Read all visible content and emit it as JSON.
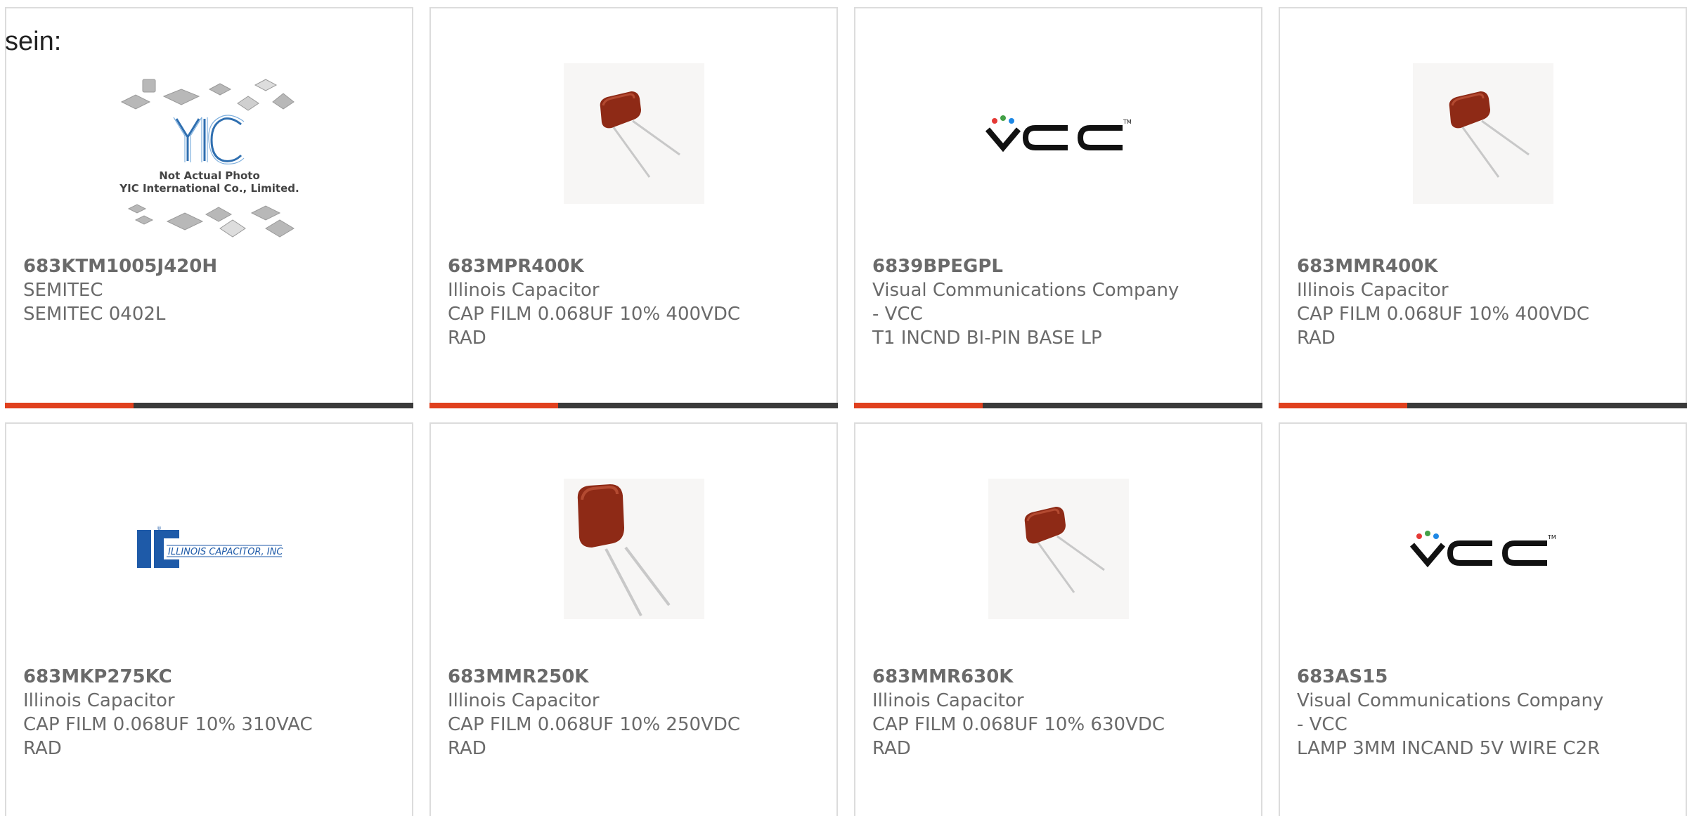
{
  "intro_text": "sein:",
  "theme": {
    "accent_color": "#e0401e",
    "bar_dark_color": "#3a3a3a",
    "text_color": "#6a6a6a"
  },
  "products": [
    {
      "part_number": "683KTM1005J420H",
      "manufacturer": "SEMITEC",
      "description": "SEMITEC 0402L",
      "image": "not-actual-photo-yic",
      "image_text": {
        "logo": "YIC",
        "line1": "Not Actual Photo",
        "line2": "YIC International Co., Limited."
      }
    },
    {
      "part_number": "683MPR400K",
      "manufacturer": "Illinois Capacitor",
      "description": "CAP FILM 0.068UF 10% 400VDC\nRAD",
      "image": "film-capacitor-photo"
    },
    {
      "part_number": "6839BPEGPL",
      "manufacturer": "Visual Communications Company\n- VCC",
      "description": "T1 INCND BI-PIN BASE LP",
      "image": "vcc-logo",
      "image_text": {
        "logo": "VCC"
      }
    },
    {
      "part_number": "683MMR400K",
      "manufacturer": "Illinois Capacitor",
      "description": "CAP FILM 0.068UF 10% 400VDC\nRAD",
      "image": "film-capacitor-photo"
    },
    {
      "part_number": "683MKP275KC",
      "manufacturer": "Illinois Capacitor",
      "description": "CAP FILM 0.068UF 10% 310VAC\nRAD",
      "image": "illinois-capacitor-logo",
      "image_text": {
        "logo": "ILLINOIS CAPACITOR, INC."
      }
    },
    {
      "part_number": "683MMR250K",
      "manufacturer": "Illinois Capacitor",
      "description": "CAP FILM 0.068UF 10% 250VDC\nRAD",
      "image": "film-capacitor-photo-large"
    },
    {
      "part_number": "683MMR630K",
      "manufacturer": "Illinois Capacitor",
      "description": "CAP FILM 0.068UF 10% 630VDC\nRAD",
      "image": "film-capacitor-photo"
    },
    {
      "part_number": "683AS15",
      "manufacturer": "Visual Communications Company\n- VCC",
      "description": "LAMP 3MM INCAND 5V WIRE C2R",
      "image": "vcc-logo",
      "image_text": {
        "logo": "VCC"
      }
    }
  ]
}
